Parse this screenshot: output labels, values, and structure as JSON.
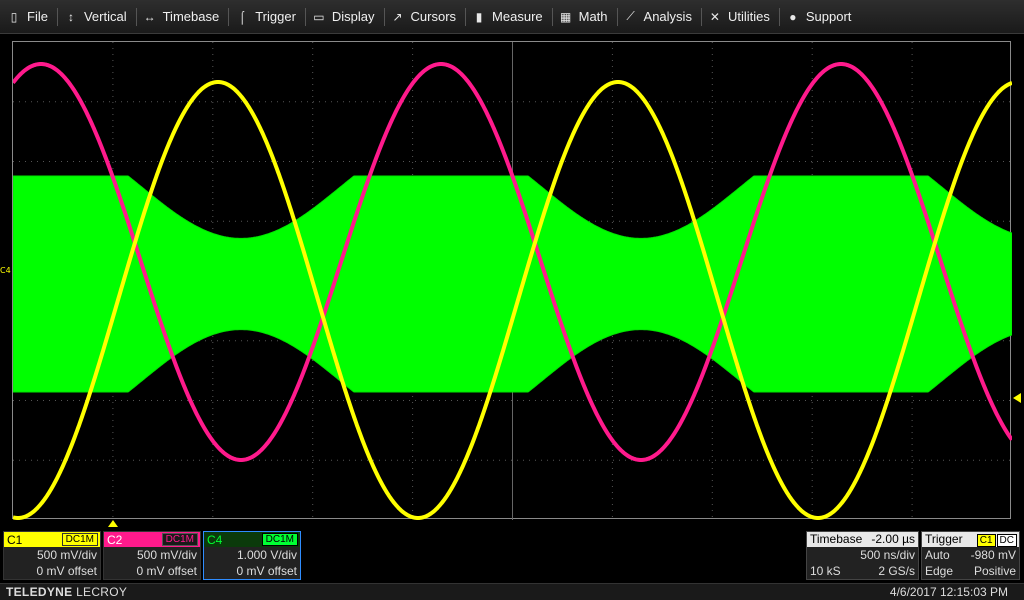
{
  "menu": [
    {
      "label": "File",
      "icon": "file-icon",
      "glyph": "▯"
    },
    {
      "label": "Vertical",
      "icon": "vertical-arrows-icon",
      "glyph": "↕"
    },
    {
      "label": "Timebase",
      "icon": "horizontal-arrows-icon",
      "glyph": "↔"
    },
    {
      "label": "Trigger",
      "icon": "trigger-icon",
      "glyph": "⌠"
    },
    {
      "label": "Display",
      "icon": "display-icon",
      "glyph": "▭"
    },
    {
      "label": "Cursors",
      "icon": "cursor-icon",
      "glyph": "↗"
    },
    {
      "label": "Measure",
      "icon": "measure-icon",
      "glyph": "▮"
    },
    {
      "label": "Math",
      "icon": "math-icon",
      "glyph": "▦"
    },
    {
      "label": "Analysis",
      "icon": "analysis-icon",
      "glyph": "⟋"
    },
    {
      "label": "Utilities",
      "icon": "utilities-icon",
      "glyph": "✕"
    },
    {
      "label": "Support",
      "icon": "support-icon",
      "glyph": "●"
    }
  ],
  "grid_marker": "C4",
  "channels": {
    "c1": {
      "name": "C1",
      "coupling": "DC1M",
      "vdiv": "500 mV/div",
      "offset": "0 mV offset",
      "color": "#ffff00"
    },
    "c2": {
      "name": "C2",
      "coupling": "DC1M",
      "vdiv": "500 mV/div",
      "offset": "0 mV offset",
      "color": "#ff1a8c"
    },
    "c4": {
      "name": "C4",
      "coupling": "DC1M",
      "vdiv": "1.000 V/div",
      "offset": "0 mV offset",
      "color": "#00ff33"
    }
  },
  "timebase": {
    "label": "Timebase",
    "delay": "-2.00 µs",
    "tdiv": "500 ns/div",
    "samples": "10 kS",
    "rate": "2 GS/s"
  },
  "trigger": {
    "label": "Trigger",
    "source": "C1",
    "coupling": "DC",
    "mode": "Auto",
    "level": "-980 mV",
    "type": "Edge",
    "slope": "Positive"
  },
  "footer": {
    "brand_bold": "TELEDYNE",
    "brand_light": "LECROY",
    "datetime": "4/6/2017 12:15:03 PM"
  }
}
